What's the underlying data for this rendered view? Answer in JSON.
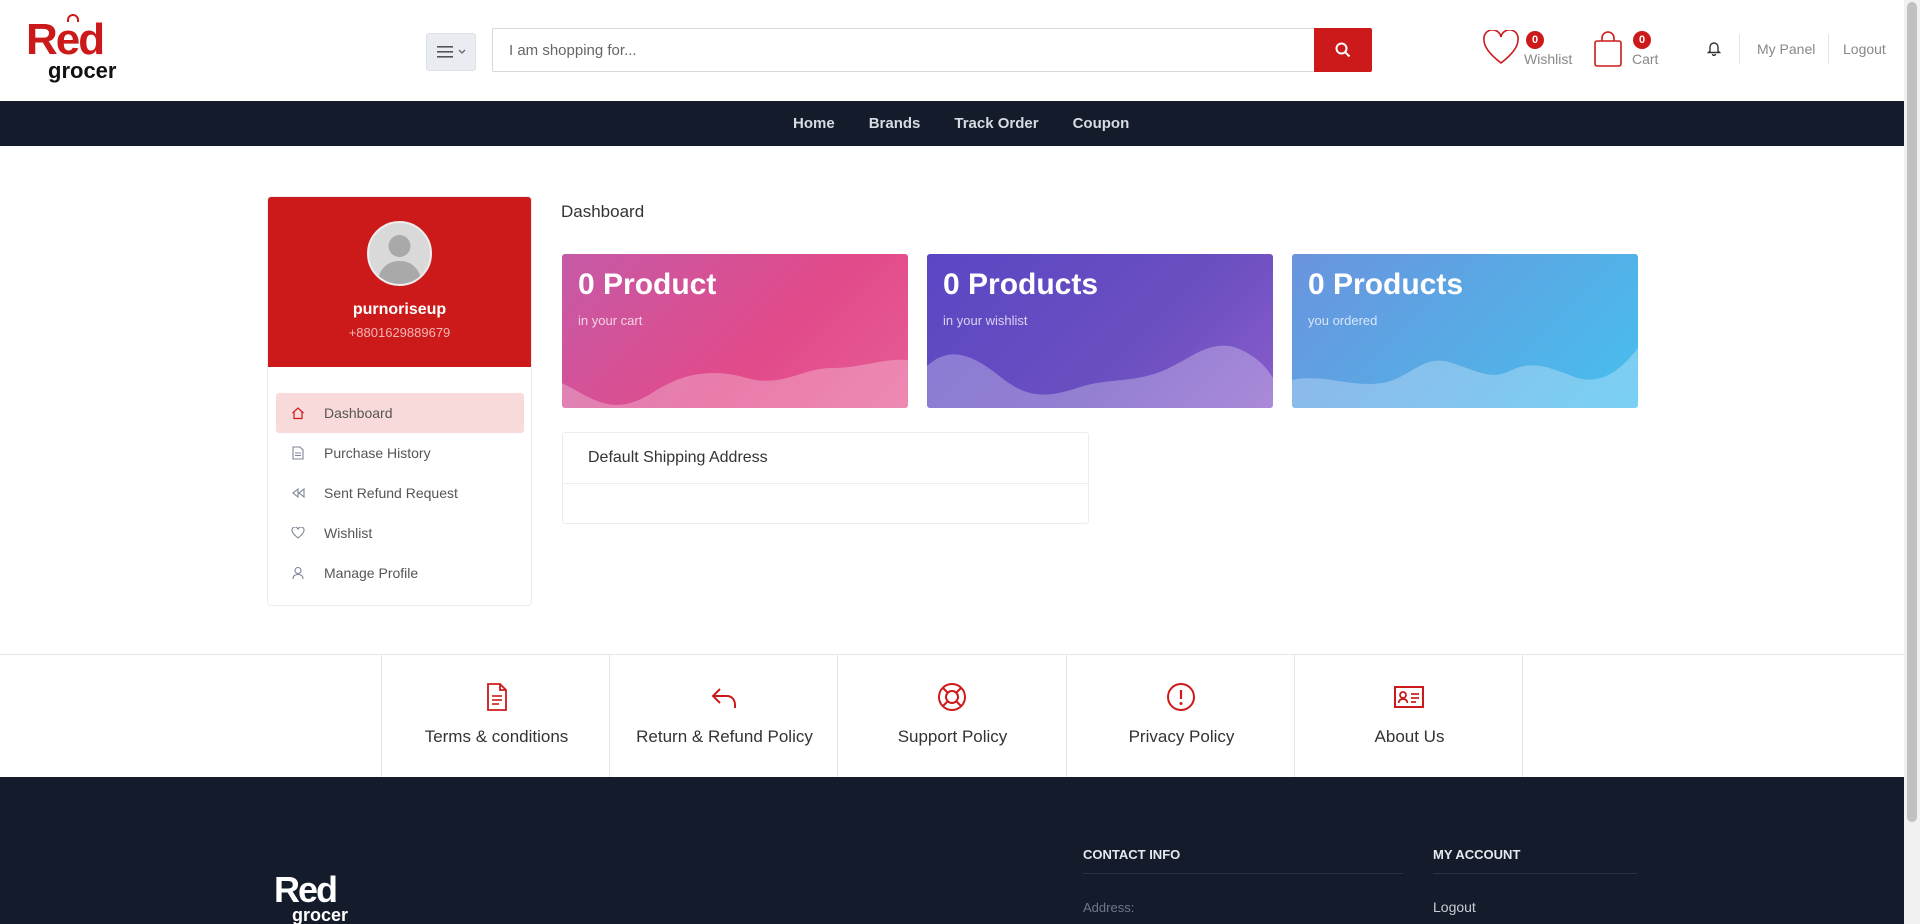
{
  "brand": {
    "logo_main": "Red",
    "logo_sub": "grocer",
    "accent": "#cc1a1a",
    "dark": "#141c2b"
  },
  "header": {
    "category_icon": "hamburger-icon",
    "search": {
      "placeholder": "I am shopping for...",
      "value": ""
    },
    "wishlist": {
      "label": "Wishlist",
      "count": "0"
    },
    "cart": {
      "label": "Cart",
      "count": "0"
    },
    "links": {
      "panel": "My Panel",
      "logout": "Logout"
    }
  },
  "nav": {
    "items": [
      "Home",
      "Brands",
      "Track Order",
      "Coupon"
    ]
  },
  "profile": {
    "name": "purnoriseup",
    "phone": "+8801629889679"
  },
  "sidebar": {
    "items": [
      {
        "label": "Dashboard",
        "icon": "home-icon",
        "active": true
      },
      {
        "label": "Purchase History",
        "icon": "document-icon",
        "active": false
      },
      {
        "label": "Sent Refund Request",
        "icon": "rewind-icon",
        "active": false
      },
      {
        "label": "Wishlist",
        "icon": "heart-icon",
        "active": false
      },
      {
        "label": "Manage Profile",
        "icon": "user-icon",
        "active": false
      }
    ]
  },
  "main": {
    "title": "Dashboard",
    "cards": [
      {
        "value": "0 Product",
        "caption": "in your cart"
      },
      {
        "value": "0 Products",
        "caption": "in your wishlist"
      },
      {
        "value": "0 Products",
        "caption": "you ordered"
      }
    ],
    "shipping": {
      "title": "Default Shipping Address"
    }
  },
  "policies": [
    {
      "label": "Terms & conditions",
      "icon": "document-icon"
    },
    {
      "label": "Return & Refund Policy",
      "icon": "return-arrow-icon"
    },
    {
      "label": "Support Policy",
      "icon": "lifebuoy-icon"
    },
    {
      "label": "Privacy Policy",
      "icon": "alert-circle-icon"
    },
    {
      "label": "About Us",
      "icon": "id-card-icon"
    }
  ],
  "footer": {
    "contact_heading": "CONTACT INFO",
    "address_label": "Address:",
    "account_heading": "MY ACCOUNT",
    "account_links": [
      "Logout"
    ]
  }
}
